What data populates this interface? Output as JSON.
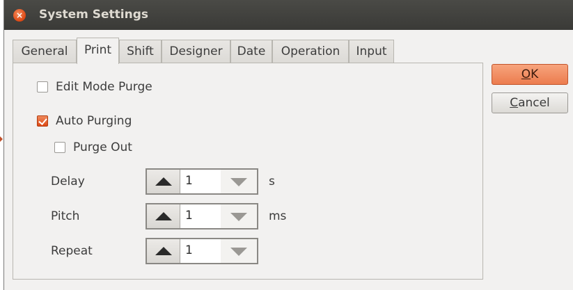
{
  "window": {
    "title": "System Settings"
  },
  "tabs": [
    {
      "label": "General",
      "active": false
    },
    {
      "label": "Print",
      "active": true
    },
    {
      "label": "Shift",
      "active": false
    },
    {
      "label": "Designer",
      "active": false
    },
    {
      "label": "Date",
      "active": false
    },
    {
      "label": "Operation",
      "active": false
    },
    {
      "label": "Input",
      "active": false
    }
  ],
  "print": {
    "edit_mode_purge": {
      "label": "Edit Mode Purge",
      "checked": false
    },
    "auto_purging": {
      "label": "Auto Purging",
      "checked": true
    },
    "purge_out": {
      "label": "Purge Out",
      "checked": false
    },
    "delay": {
      "label": "Delay",
      "value": "1",
      "unit": "s"
    },
    "pitch": {
      "label": "Pitch",
      "value": "1",
      "unit": "ms"
    },
    "repeat": {
      "label": "Repeat",
      "value": "1"
    }
  },
  "buttons": {
    "ok": {
      "mnemonic": "O",
      "rest": "K"
    },
    "cancel": {
      "mnemonic": "C",
      "rest": "ancel"
    }
  },
  "colors": {
    "accent": "#dd4814",
    "ok_button": "#ec7c4e",
    "titlebar": "#3c3b37"
  },
  "icons": {
    "close": "close-icon",
    "spin_up": "triangle-up-icon",
    "spin_down": "triangle-down-icon",
    "check": "checkmark-icon"
  }
}
